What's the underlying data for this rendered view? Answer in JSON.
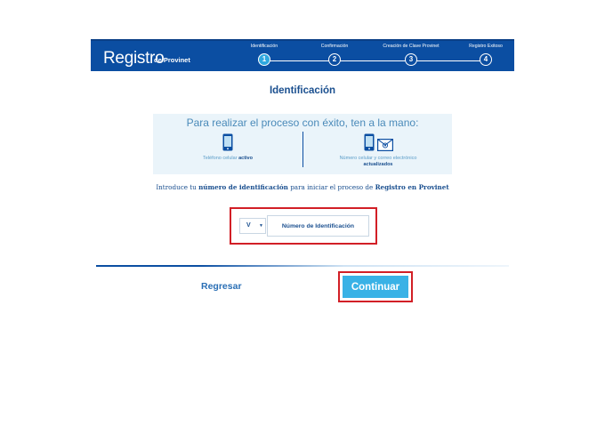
{
  "header": {
    "logo_text": "Registro",
    "logo_sub": "de Provinet",
    "steps": [
      {
        "label": "Identificación",
        "number": "1"
      },
      {
        "label": "Confirmación",
        "number": "2"
      },
      {
        "label": "Creación de Clave Provinet",
        "number": "3"
      },
      {
        "label": "Registro Exitoso",
        "number": "4"
      }
    ]
  },
  "page": {
    "title": "Identificación"
  },
  "info": {
    "title": "Para realizar el proceso con éxito, ten a la mano:",
    "left_text": "Teléfono celular",
    "left_bold": "activo",
    "right_text": "Número celular y correo electrónico",
    "right_bold": "actualizados"
  },
  "intro": {
    "part1": "Introduce tu",
    "bold1": "número de identificación",
    "part2": "para iniciar el proceso de",
    "bold2": "Registro en Provinet"
  },
  "form": {
    "doc_type": "V",
    "id_placeholder": "Número de Identificación"
  },
  "actions": {
    "back_label": "Regresar",
    "continue_label": "Continuar"
  },
  "colors": {
    "brand_blue": "#0b4ea2",
    "accent_cyan": "#39b2e6",
    "highlight_red": "#d21f26"
  }
}
